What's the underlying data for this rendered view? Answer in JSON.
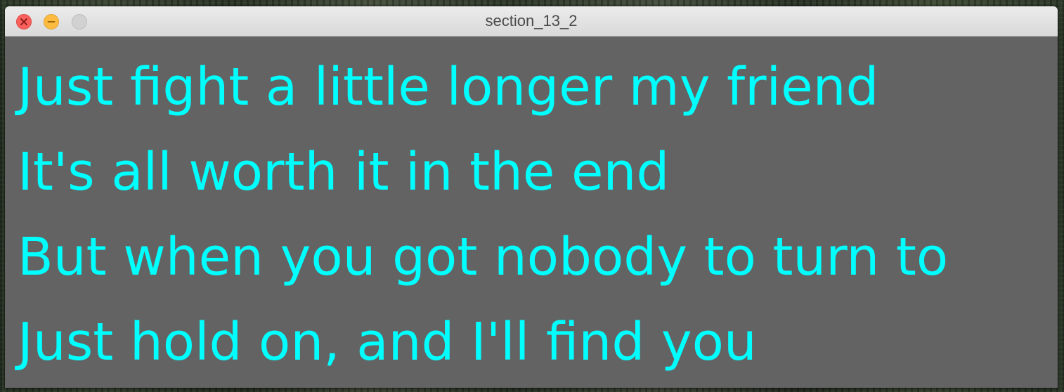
{
  "window": {
    "title": "section_13_2",
    "controls": {
      "close": "close-icon",
      "minimize": "minimize-icon",
      "zoom": "zoom-icon"
    }
  },
  "lyrics": [
    "Just fight a little longer my friend",
    "It's all worth it in the end",
    "But when you got nobody to turn to",
    "Just hold on, and I'll find you"
  ],
  "colors": {
    "background": "#636363",
    "text": "#00ffff"
  }
}
